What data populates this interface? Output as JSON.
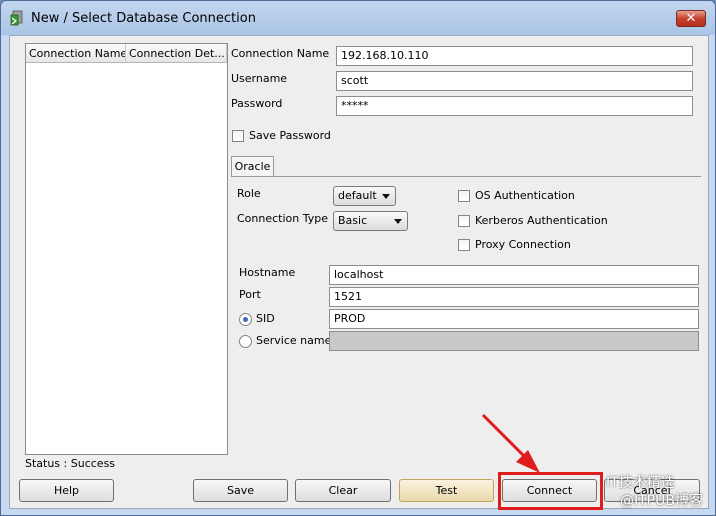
{
  "window": {
    "title": "New / Select Database Connection",
    "close": "✕"
  },
  "connections": {
    "headers": [
      "Connection Name",
      "Connection Det..."
    ]
  },
  "form": {
    "connection_name": {
      "label": "Connection Name",
      "value": "192.168.10.110"
    },
    "username": {
      "label": "Username",
      "value": "scott"
    },
    "password": {
      "label": "Password",
      "value": "*****"
    },
    "save_password": {
      "label": "Save Password",
      "checked": false
    }
  },
  "tabs": [
    {
      "label": "Oracle",
      "selected": true
    }
  ],
  "oracle": {
    "role": {
      "label": "Role",
      "value": "default"
    },
    "connection_type": {
      "label": "Connection Type",
      "value": "Basic"
    },
    "os_auth": {
      "label": "OS Authentication",
      "checked": false
    },
    "kerberos_auth": {
      "label": "Kerberos Authentication",
      "checked": false
    },
    "proxy_conn": {
      "label": "Proxy Connection",
      "checked": false
    },
    "hostname": {
      "label": "Hostname",
      "value": "localhost"
    },
    "port": {
      "label": "Port",
      "value": "1521"
    },
    "sid": {
      "label": "SID",
      "value": "PROD",
      "selected": true
    },
    "service_name": {
      "label": "Service name",
      "value": "",
      "selected": false
    }
  },
  "status": "Status : Success",
  "buttons": {
    "help": "Help",
    "save": "Save",
    "clear": "Clear",
    "test": "Test",
    "connect": "Connect",
    "cancel": "Cancel"
  },
  "watermark": {
    "line1": "IT技术精选",
    "line2": "@ITPUB博客"
  },
  "colors": {
    "highlight": "#e01d1d",
    "title_bar": "#aac5e6",
    "dialog_bg": "#eeeeee"
  }
}
